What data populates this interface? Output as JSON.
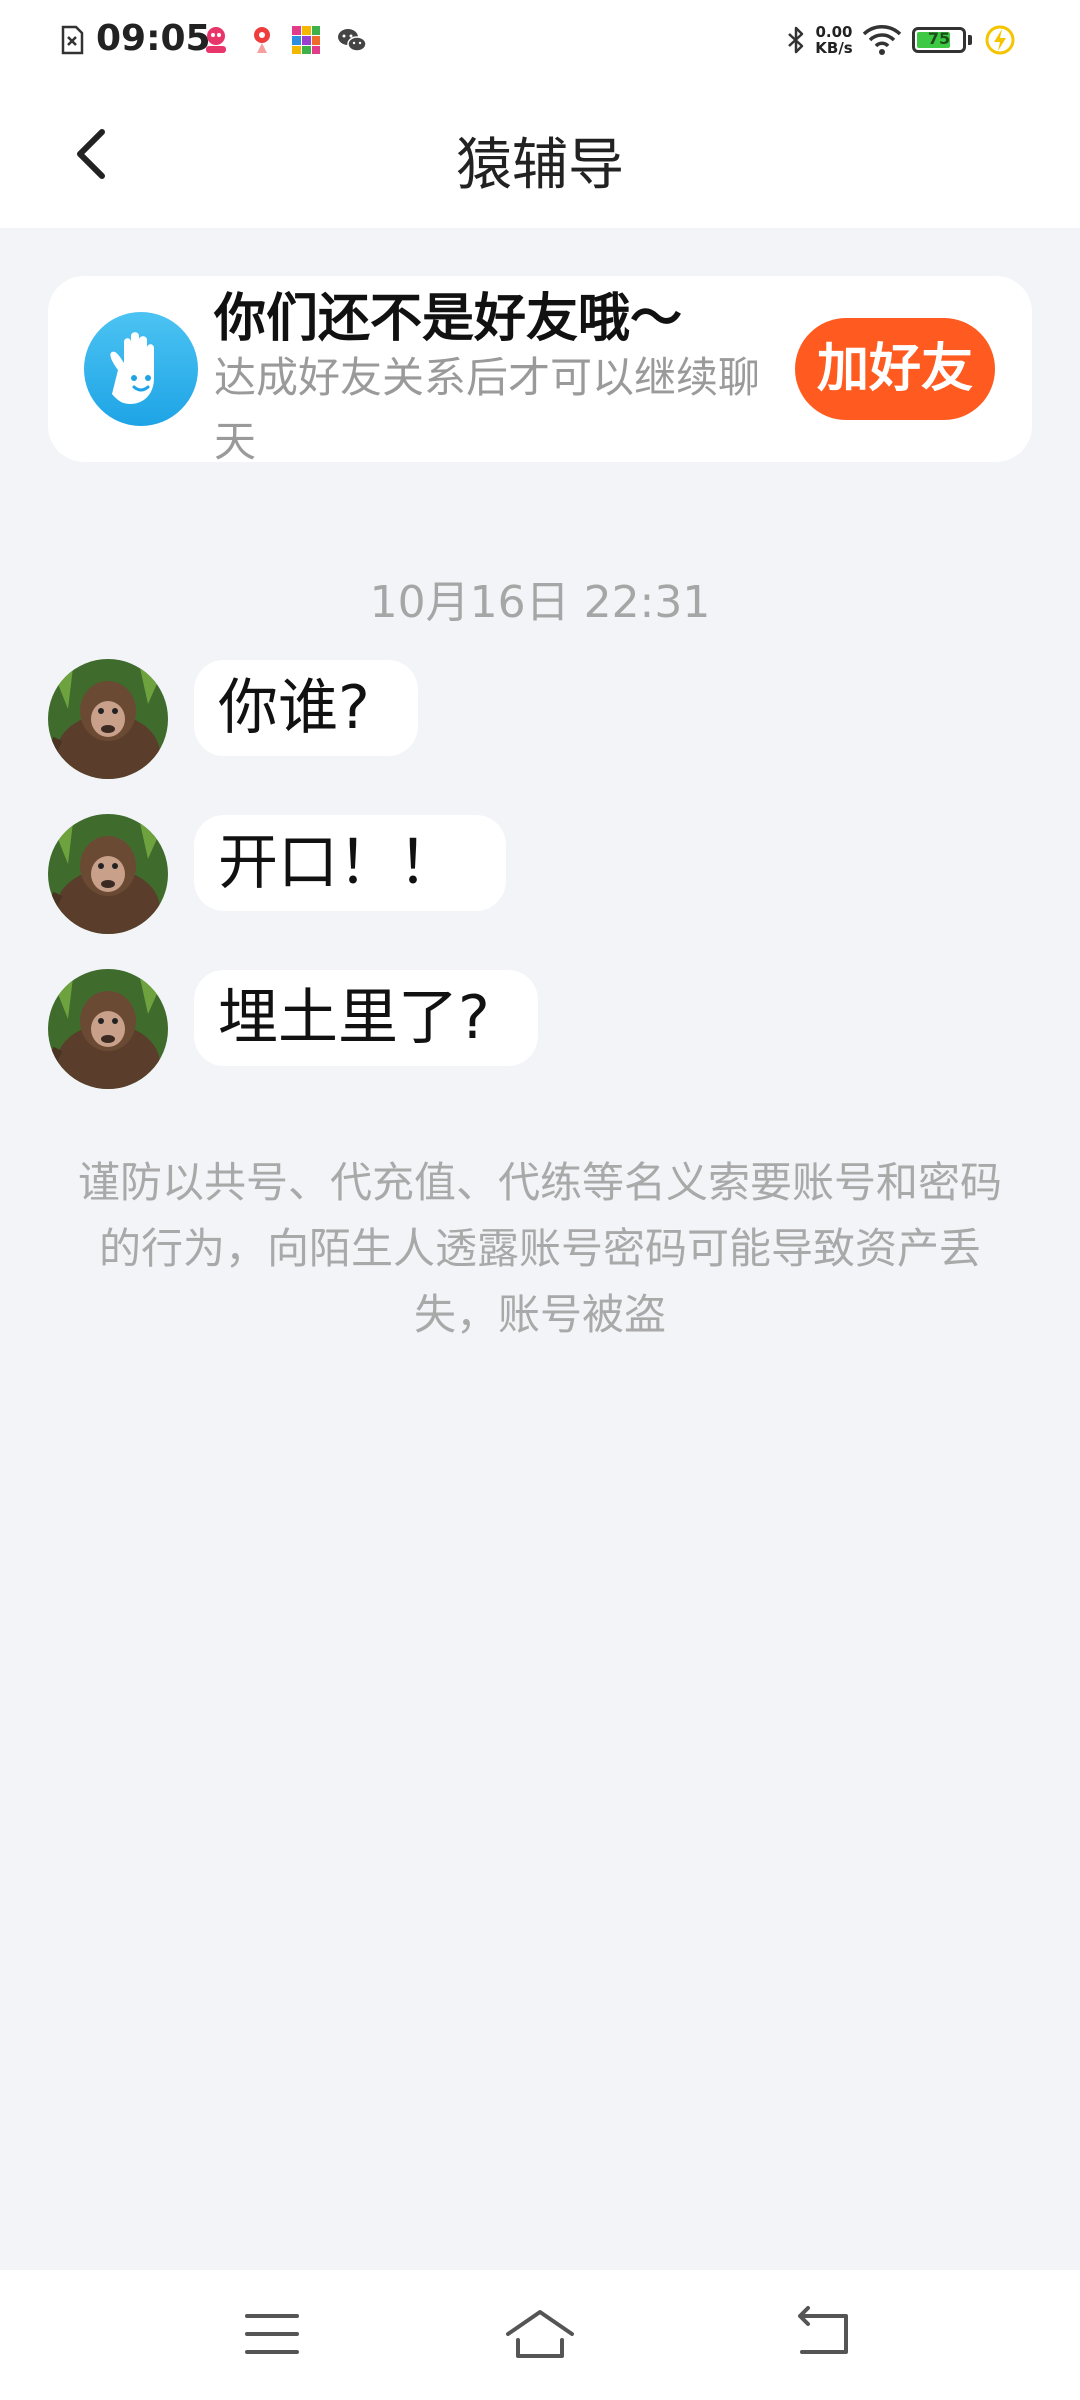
{
  "status_bar": {
    "time": "09:05",
    "net_speed_value": "0.00",
    "net_speed_unit": "KB/s",
    "battery_level": "75",
    "battery_fraction": 0.75,
    "icons": [
      "sim-error-icon",
      "notification-app-icon-1",
      "notification-app-icon-2",
      "notification-app-icon-3",
      "wechat-icon",
      "bluetooth-icon",
      "wifi-icon",
      "battery-icon",
      "charging-icon"
    ]
  },
  "header": {
    "title": "猿辅导",
    "back_icon": "chevron-left-icon"
  },
  "friend_prompt": {
    "title": "你们还不是好友哦～",
    "subtitle": "达成好友关系后才可以继续聊天",
    "button_label": "加好友",
    "button_color": "#ff5a1f",
    "icon": "waving-hand-icon"
  },
  "chat": {
    "timestamp": "10月16日 22:31",
    "messages": [
      {
        "text": "你谁?"
      },
      {
        "text": "开口！！"
      },
      {
        "text": "埋土里了?"
      }
    ]
  },
  "warning": "谨防以共号、代充值、代练等名义索要账号和密码的行为，向陌生人透露账号密码可能导致资产丢失，账号被盗",
  "nav_bar": {
    "icons": [
      "menu-icon",
      "home-icon",
      "back-icon"
    ]
  }
}
